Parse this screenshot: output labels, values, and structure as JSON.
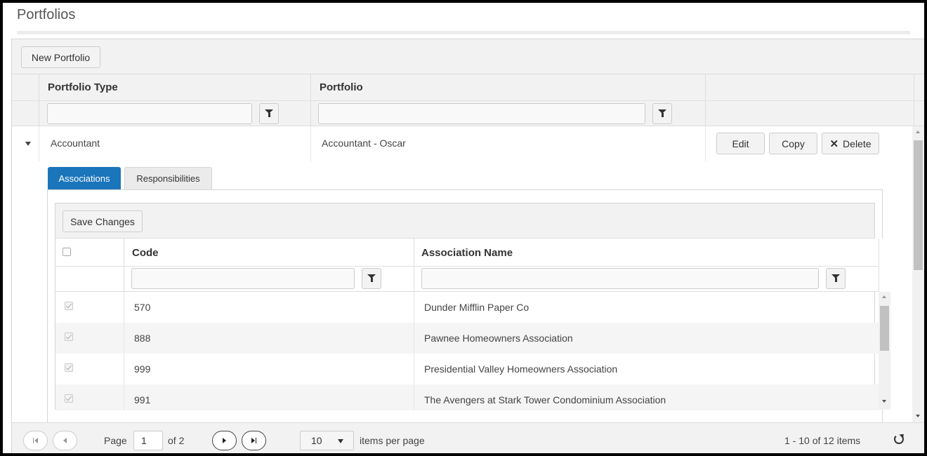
{
  "page": {
    "title": "Portfolios"
  },
  "toolbar": {
    "new_portfolio_label": "New Portfolio"
  },
  "columns": {
    "portfolio_type": "Portfolio Type",
    "portfolio": "Portfolio"
  },
  "filters": {
    "portfolio_type_value": "",
    "portfolio_value": ""
  },
  "row": {
    "portfolio_type": "Accountant",
    "portfolio": "Accountant - Oscar",
    "edit_label": "Edit",
    "copy_label": "Copy",
    "delete_label": "Delete"
  },
  "icons": {
    "expand": "caret-down-icon",
    "filter": "filter-funnel-icon",
    "delete": "x-icon",
    "refresh": "refresh-icon"
  },
  "detail": {
    "tabs": [
      {
        "label": "Associations",
        "active": true
      },
      {
        "label": "Responsibilities",
        "active": false
      }
    ],
    "save_label": "Save Changes",
    "columns": {
      "code": "Code",
      "association_name": "Association Name"
    },
    "rows": [
      {
        "code": "570",
        "name": "Dunder Mifflin Paper Co",
        "checked": true
      },
      {
        "code": "888",
        "name": "Pawnee Homeowners Association",
        "checked": true
      },
      {
        "code": "999",
        "name": "Presidential Valley Homeowners Association",
        "checked": true
      },
      {
        "code": "991",
        "name": "The Avengers at Stark Tower Condominium Association",
        "checked": true
      }
    ]
  },
  "pager": {
    "page_label": "Page",
    "page_value": "1",
    "of_label": "of 2",
    "page_size": "10",
    "items_per_page_label": "items per page",
    "summary": "1 - 10 of 12 items"
  },
  "colors": {
    "accent": "#1b75bb",
    "header_bg": "#f2f2f2",
    "alt_row": "#f5f5f5"
  }
}
